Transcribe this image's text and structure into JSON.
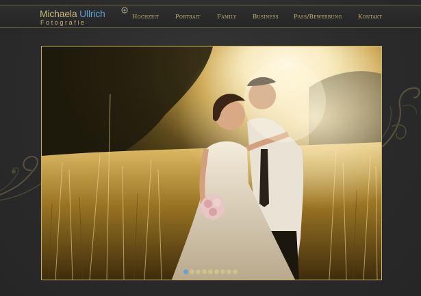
{
  "brand": {
    "name_part1": "Michaela ",
    "name_accent": "Ullrich",
    "subtitle": "Fotografie"
  },
  "nav": {
    "items": [
      {
        "label": "Hochzeit"
      },
      {
        "label": "Portrait"
      },
      {
        "label": "Family"
      },
      {
        "label": "Business"
      },
      {
        "label": "Pass/Bewerbung"
      },
      {
        "label": "Kontakt"
      }
    ]
  },
  "slideshow": {
    "slide_count": 9,
    "active_index": 0
  },
  "colors": {
    "accent_gold": "#c9b779",
    "accent_blue": "#5e9fcf",
    "background": "#2b2b2b"
  }
}
